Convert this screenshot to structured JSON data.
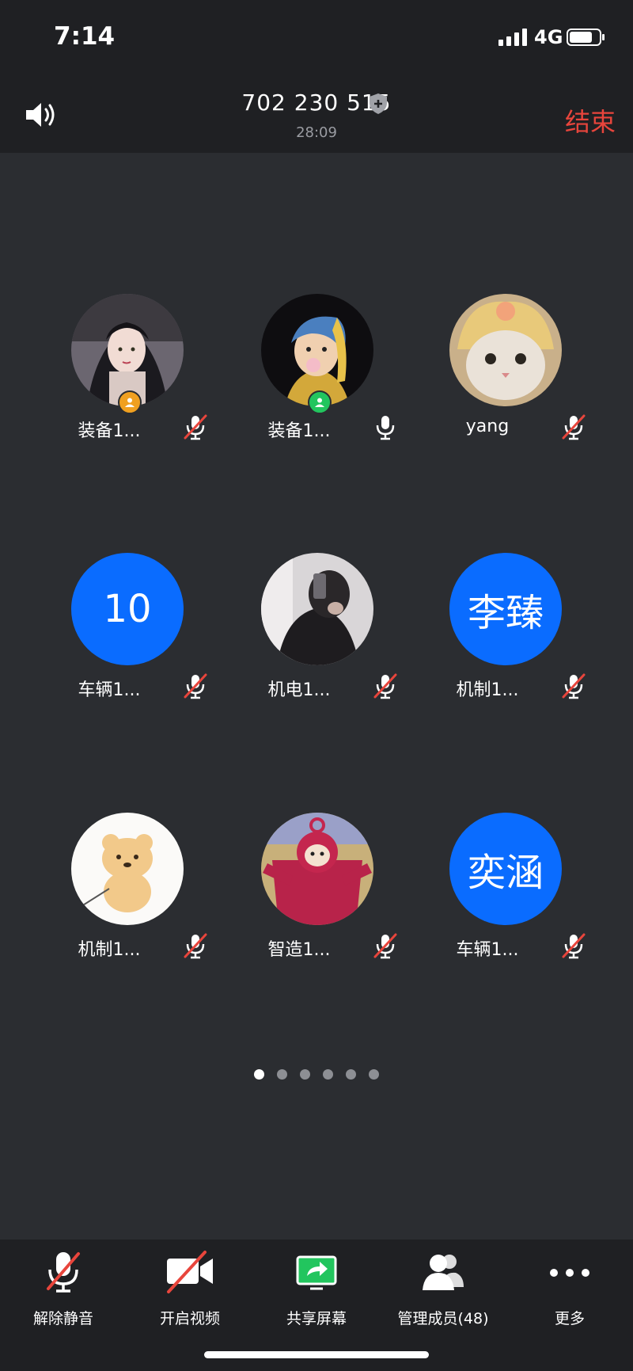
{
  "status_bar": {
    "time": "7:14",
    "network": "4G"
  },
  "header": {
    "meeting_id": "702 230 515",
    "duration": "28:09",
    "end_label": "结束"
  },
  "participants": [
    {
      "name": "装备1...",
      "avatar": "photo-girl",
      "mic": "muted",
      "badge": "host-orange"
    },
    {
      "name": "装备1...",
      "avatar": "photo-painting",
      "mic": "on",
      "badge": "cohost-green"
    },
    {
      "name": "yang",
      "avatar": "photo-cat",
      "mic": "muted"
    },
    {
      "name": "车辆1...",
      "avatar_text": "10",
      "mic": "muted"
    },
    {
      "name": "机电1...",
      "avatar": "photo-mirror",
      "mic": "muted"
    },
    {
      "name": "机制1...",
      "avatar_text": "李臻",
      "mic": "muted"
    },
    {
      "name": "机制1...",
      "avatar": "photo-bear",
      "mic": "muted"
    },
    {
      "name": "智造1...",
      "avatar": "photo-teletubby",
      "mic": "muted"
    },
    {
      "name": "车辆1...",
      "avatar_text": "奕涵",
      "mic": "muted"
    }
  ],
  "pagination": {
    "pages": 6,
    "current": 1
  },
  "toolbar": {
    "unmute": "解除静音",
    "start_video": "开启视频",
    "share_screen": "共享屏幕",
    "manage_members": "管理成员(48)",
    "more": "更多"
  },
  "colors": {
    "background": "#2b2d31",
    "bar": "#1f2023",
    "accent_blue": "#0a6cff",
    "end_red": "#e8453c",
    "share_green": "#22c55e"
  }
}
